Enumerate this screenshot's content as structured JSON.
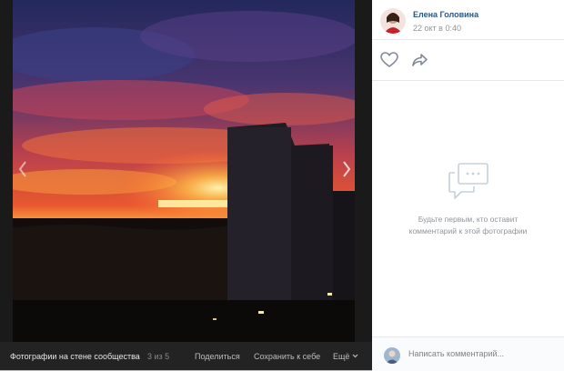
{
  "photo": {
    "description_icon": "sunset-city-photo",
    "sky_colors": [
      "#2c2f6b",
      "#7a3a6a",
      "#d8493a",
      "#f48a2a",
      "#ffcf52"
    ]
  },
  "bottom_bar": {
    "album_label": "Фотографии на стене сообщества",
    "counter": "3 из 5",
    "share_label": "Поделиться",
    "save_label": "Сохранить к себе",
    "more_label": "Ещё"
  },
  "author": {
    "name": "Елена Головина",
    "date": "22 окт в 0:40"
  },
  "empty_comments": {
    "line1": "Будьте первым, кто оставит",
    "line2": "комментарий к этой фотографии"
  },
  "comment": {
    "placeholder": "Написать комментарий..."
  },
  "colors": {
    "link": "#2a5885",
    "muted": "#939393",
    "icon": "#828a99"
  }
}
